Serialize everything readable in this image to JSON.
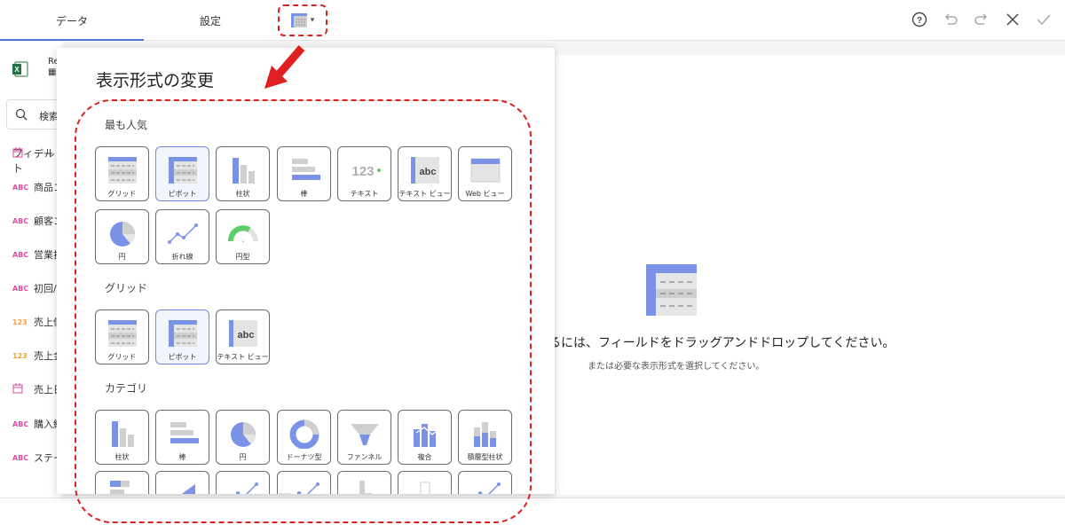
{
  "tabs": {
    "data": "データ",
    "settings": "設定"
  },
  "left_panel": {
    "datasource_name": "Re",
    "search_label": "検索",
    "fields_title": "フィールト",
    "fields": [
      {
        "type": "date",
        "label": "デー"
      },
      {
        "type": "ABC",
        "label": "商品コ"
      },
      {
        "type": "ABC",
        "label": "顧客コ"
      },
      {
        "type": "ABC",
        "label": "営業担"
      },
      {
        "type": "ABC",
        "label": "初回/"
      },
      {
        "type": "123",
        "label": "売上個"
      },
      {
        "type": "123",
        "label": "売上金"
      },
      {
        "type": "date",
        "label": "売上日"
      },
      {
        "type": "ABC",
        "label": "購入経"
      },
      {
        "type": "ABC",
        "label": "ステー"
      }
    ]
  },
  "canvas": {
    "empty_main": "るには、フィールドをドラッグアンドドロップしてください。",
    "empty_sub": "または必要な表示形式を選択してください。"
  },
  "popup": {
    "title": "表示形式の変更",
    "sections": {
      "popular": "最も人気",
      "grid": "グリッド",
      "category": "カテゴリ"
    },
    "popular_tiles": [
      {
        "icon": "grid",
        "label": "グリッド",
        "selected": false
      },
      {
        "icon": "pivot",
        "label": "ピボット",
        "selected": true
      },
      {
        "icon": "column",
        "label": "柱状",
        "selected": false
      },
      {
        "icon": "bar",
        "label": "棒",
        "selected": false
      },
      {
        "icon": "text",
        "label": "テキスト",
        "selected": false
      },
      {
        "icon": "textview",
        "label": "テキスト ビュー",
        "selected": false
      },
      {
        "icon": "webview",
        "label": "Web ビュー",
        "selected": false
      },
      {
        "icon": "pie",
        "label": "円",
        "selected": false
      },
      {
        "icon": "line",
        "label": "折れ線",
        "selected": false
      },
      {
        "icon": "gauge",
        "label": "円型",
        "selected": false
      }
    ],
    "grid_tiles": [
      {
        "icon": "grid",
        "label": "グリッド",
        "selected": false
      },
      {
        "icon": "pivot",
        "label": "ピボット",
        "selected": true
      },
      {
        "icon": "textview",
        "label": "テキスト ビュー",
        "selected": false
      }
    ],
    "category_tiles": [
      {
        "icon": "column",
        "label": "柱状",
        "selected": false
      },
      {
        "icon": "bar",
        "label": "棒",
        "selected": false
      },
      {
        "icon": "pie",
        "label": "円",
        "selected": false
      },
      {
        "icon": "donut",
        "label": "ドーナツ型",
        "selected": false
      },
      {
        "icon": "funnel",
        "label": "ファンネル",
        "selected": false
      },
      {
        "icon": "combo",
        "label": "複合",
        "selected": false
      },
      {
        "icon": "stacked",
        "label": "積層型柱状",
        "selected": false
      }
    ],
    "partial_tiles": [
      {
        "icon": "stacked-bar"
      },
      {
        "icon": "area"
      },
      {
        "icon": "line"
      },
      {
        "icon": "line"
      },
      {
        "icon": "step"
      },
      {
        "icon": "blank"
      },
      {
        "icon": "line"
      }
    ],
    "text_icon_label": "123",
    "textview_icon_label": "abc"
  }
}
